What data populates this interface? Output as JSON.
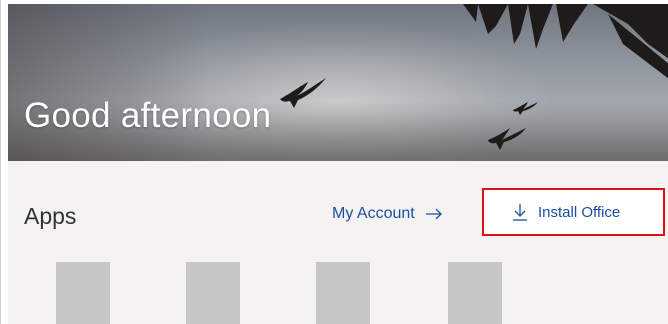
{
  "hero": {
    "greeting": "Good afternoon"
  },
  "apps_section": {
    "title": "Apps",
    "my_account_label": "My Account",
    "my_account_icon": "arrow-right-icon",
    "install_office_label": "Install Office",
    "install_office_icon": "download-icon",
    "app_tiles": [
      {
        "name": "app-tile-1"
      },
      {
        "name": "app-tile-2"
      },
      {
        "name": "app-tile-3"
      },
      {
        "name": "app-tile-4"
      }
    ]
  },
  "colors": {
    "link_blue": "#1a4fa3",
    "highlight_red": "#e01010",
    "content_bg": "#f4f3f2",
    "tile_gray": "#c6c6c6"
  }
}
